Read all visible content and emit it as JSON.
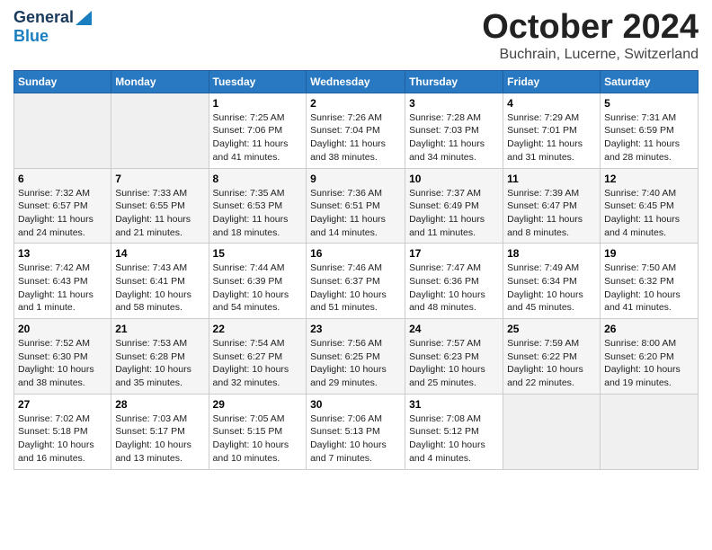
{
  "header": {
    "logo_line1": "General",
    "logo_line2": "Blue",
    "month_title": "October 2024",
    "location": "Buchrain, Lucerne, Switzerland"
  },
  "days_of_week": [
    "Sunday",
    "Monday",
    "Tuesday",
    "Wednesday",
    "Thursday",
    "Friday",
    "Saturday"
  ],
  "weeks": [
    [
      {
        "day": "",
        "info": ""
      },
      {
        "day": "",
        "info": ""
      },
      {
        "day": "1",
        "info": "Sunrise: 7:25 AM\nSunset: 7:06 PM\nDaylight: 11 hours and 41 minutes."
      },
      {
        "day": "2",
        "info": "Sunrise: 7:26 AM\nSunset: 7:04 PM\nDaylight: 11 hours and 38 minutes."
      },
      {
        "day": "3",
        "info": "Sunrise: 7:28 AM\nSunset: 7:03 PM\nDaylight: 11 hours and 34 minutes."
      },
      {
        "day": "4",
        "info": "Sunrise: 7:29 AM\nSunset: 7:01 PM\nDaylight: 11 hours and 31 minutes."
      },
      {
        "day": "5",
        "info": "Sunrise: 7:31 AM\nSunset: 6:59 PM\nDaylight: 11 hours and 28 minutes."
      }
    ],
    [
      {
        "day": "6",
        "info": "Sunrise: 7:32 AM\nSunset: 6:57 PM\nDaylight: 11 hours and 24 minutes."
      },
      {
        "day": "7",
        "info": "Sunrise: 7:33 AM\nSunset: 6:55 PM\nDaylight: 11 hours and 21 minutes."
      },
      {
        "day": "8",
        "info": "Sunrise: 7:35 AM\nSunset: 6:53 PM\nDaylight: 11 hours and 18 minutes."
      },
      {
        "day": "9",
        "info": "Sunrise: 7:36 AM\nSunset: 6:51 PM\nDaylight: 11 hours and 14 minutes."
      },
      {
        "day": "10",
        "info": "Sunrise: 7:37 AM\nSunset: 6:49 PM\nDaylight: 11 hours and 11 minutes."
      },
      {
        "day": "11",
        "info": "Sunrise: 7:39 AM\nSunset: 6:47 PM\nDaylight: 11 hours and 8 minutes."
      },
      {
        "day": "12",
        "info": "Sunrise: 7:40 AM\nSunset: 6:45 PM\nDaylight: 11 hours and 4 minutes."
      }
    ],
    [
      {
        "day": "13",
        "info": "Sunrise: 7:42 AM\nSunset: 6:43 PM\nDaylight: 11 hours and 1 minute."
      },
      {
        "day": "14",
        "info": "Sunrise: 7:43 AM\nSunset: 6:41 PM\nDaylight: 10 hours and 58 minutes."
      },
      {
        "day": "15",
        "info": "Sunrise: 7:44 AM\nSunset: 6:39 PM\nDaylight: 10 hours and 54 minutes."
      },
      {
        "day": "16",
        "info": "Sunrise: 7:46 AM\nSunset: 6:37 PM\nDaylight: 10 hours and 51 minutes."
      },
      {
        "day": "17",
        "info": "Sunrise: 7:47 AM\nSunset: 6:36 PM\nDaylight: 10 hours and 48 minutes."
      },
      {
        "day": "18",
        "info": "Sunrise: 7:49 AM\nSunset: 6:34 PM\nDaylight: 10 hours and 45 minutes."
      },
      {
        "day": "19",
        "info": "Sunrise: 7:50 AM\nSunset: 6:32 PM\nDaylight: 10 hours and 41 minutes."
      }
    ],
    [
      {
        "day": "20",
        "info": "Sunrise: 7:52 AM\nSunset: 6:30 PM\nDaylight: 10 hours and 38 minutes."
      },
      {
        "day": "21",
        "info": "Sunrise: 7:53 AM\nSunset: 6:28 PM\nDaylight: 10 hours and 35 minutes."
      },
      {
        "day": "22",
        "info": "Sunrise: 7:54 AM\nSunset: 6:27 PM\nDaylight: 10 hours and 32 minutes."
      },
      {
        "day": "23",
        "info": "Sunrise: 7:56 AM\nSunset: 6:25 PM\nDaylight: 10 hours and 29 minutes."
      },
      {
        "day": "24",
        "info": "Sunrise: 7:57 AM\nSunset: 6:23 PM\nDaylight: 10 hours and 25 minutes."
      },
      {
        "day": "25",
        "info": "Sunrise: 7:59 AM\nSunset: 6:22 PM\nDaylight: 10 hours and 22 minutes."
      },
      {
        "day": "26",
        "info": "Sunrise: 8:00 AM\nSunset: 6:20 PM\nDaylight: 10 hours and 19 minutes."
      }
    ],
    [
      {
        "day": "27",
        "info": "Sunrise: 7:02 AM\nSunset: 5:18 PM\nDaylight: 10 hours and 16 minutes."
      },
      {
        "day": "28",
        "info": "Sunrise: 7:03 AM\nSunset: 5:17 PM\nDaylight: 10 hours and 13 minutes."
      },
      {
        "day": "29",
        "info": "Sunrise: 7:05 AM\nSunset: 5:15 PM\nDaylight: 10 hours and 10 minutes."
      },
      {
        "day": "30",
        "info": "Sunrise: 7:06 AM\nSunset: 5:13 PM\nDaylight: 10 hours and 7 minutes."
      },
      {
        "day": "31",
        "info": "Sunrise: 7:08 AM\nSunset: 5:12 PM\nDaylight: 10 hours and 4 minutes."
      },
      {
        "day": "",
        "info": ""
      },
      {
        "day": "",
        "info": ""
      }
    ]
  ]
}
